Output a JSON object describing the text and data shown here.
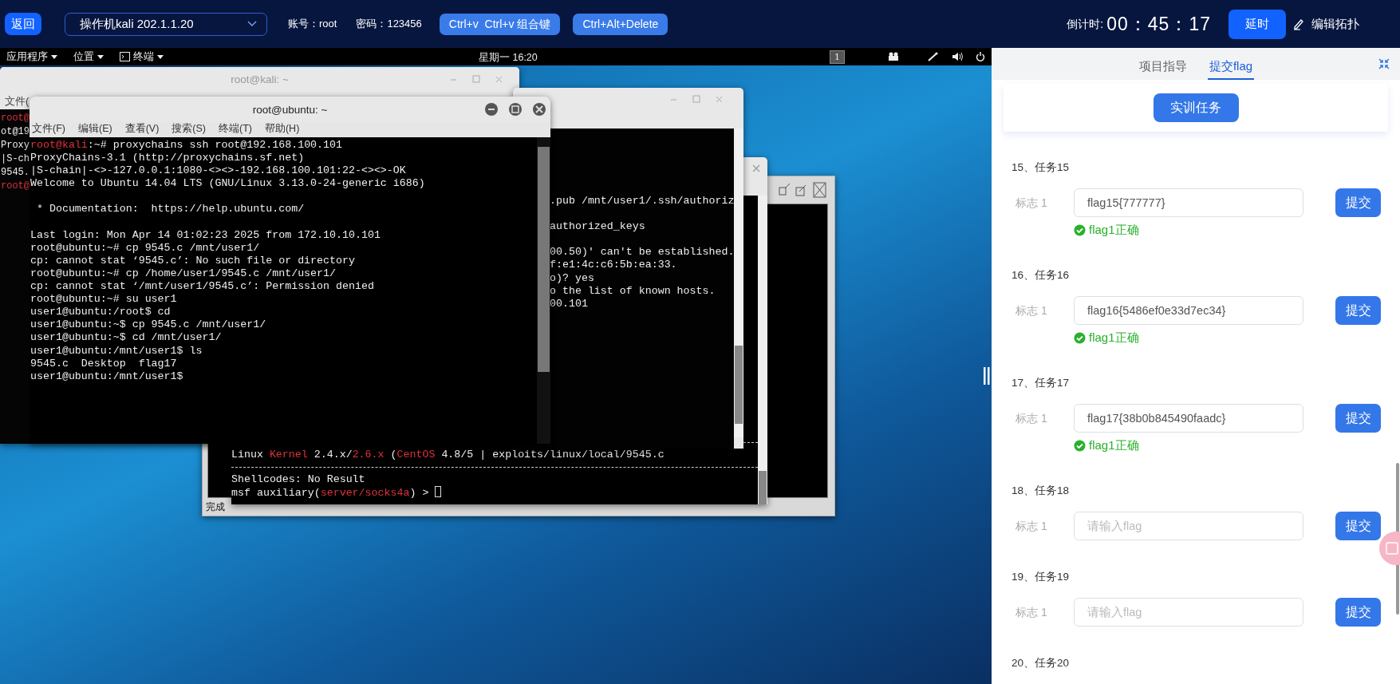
{
  "top_bar": {
    "back_button": "返回",
    "machine_select": "操作机kali 202.1.1.20",
    "account": "账号：root",
    "password": "密码：123456",
    "buttons": [
      "Ctrl+v  Ctrl+v 组合键",
      "Ctrl+Alt+Delete"
    ],
    "countdown_label": "倒计时:",
    "countdown": "00：45：17",
    "delay_button": "延时",
    "edit_topology": "编辑拓扑"
  },
  "desktop": {
    "panel": {
      "menus": [
        {
          "label": "应用程序",
          "kind": "menu"
        },
        {
          "label": "位置",
          "kind": "menu"
        },
        {
          "label": "终端",
          "kind": "terminal"
        }
      ],
      "clock": "星期一 16:20",
      "workspace": "1"
    },
    "kali_window": {
      "title": "root@kali: ~",
      "menu": "文件(",
      "lines": [
        {
          "segments": [
            {
              "text": "root@",
              "highlighted": true
            }
          ]
        },
        {
          "text": "ot@19"
        },
        {
          "text": "Proxy"
        },
        {
          "text": "|S-ch"
        },
        {
          "text": "9545."
        },
        {
          "segments": [
            {
              "text": "root@",
              "highlighted": true
            }
          ]
        }
      ]
    },
    "browser_window": {
      "status": "完成"
    },
    "msf_window": {
      "lines": [
        {
          "segments": [
            {
              "text": "Linux ",
              "highlighted": false
            },
            {
              "text": "Kernel",
              "highlighted": true
            },
            {
              "text": " 2.4.x/",
              "highlighted": false
            },
            {
              "text": "2.6.x",
              "highlighted": true
            },
            {
              "text": " (",
              "highlighted": false
            },
            {
              "text": "CentOS",
              "highlighted": true
            },
            {
              "text": " 4.8/5 | exploits/linux/local/9545.c",
              "highlighted": false
            }
          ],
          "rule_before": true,
          "rule_after": true
        },
        {
          "text": "Shellcodes: No Result"
        },
        {
          "segments": [
            {
              "text": "msf auxiliary(",
              "highlighted": false
            },
            {
              "text": "server/socks4a",
              "highlighted": true
            },
            {
              "text": ") > ",
              "highlighted": false
            }
          ],
          "cursor": true
        }
      ]
    },
    "middle_window": {
      "lines": [
        {
          "text": ".pub /mnt/user1/.ssh/authoriz"
        },
        {
          "text": "authorized_keys",
          "space_before": true
        },
        {
          "text": "00.50)' can't be established.",
          "space_before": true
        },
        {
          "text": "f:e1:4c:c6:5b:ea:33."
        },
        {
          "text": "o)? yes"
        },
        {
          "text": "o the list of known hosts."
        },
        {
          "text": "00.101"
        }
      ]
    },
    "ubuntu_window": {
      "title": "root@ubuntu: ~",
      "menu": [
        "文件(F)",
        "编辑(E)",
        "查看(V)",
        "搜索(S)",
        "终端(T)",
        "帮助(H)"
      ],
      "lines": [
        {
          "segments": [
            {
              "text": "root@kali",
              "highlighted": true
            },
            {
              "text": ":~# proxychains ssh root@192.168.100.101",
              "highlighted": false
            }
          ]
        },
        {
          "text": "ProxyChains-3.1 (http://proxychains.sf.net)"
        },
        {
          "text": "|S-chain|-<>-127.0.0.1:1080-<><>-192.168.100.101:22-<><>-OK"
        },
        {
          "text": "Welcome to Ubuntu 14.04 LTS (GNU/Linux 3.13.0-24-generic i686)"
        },
        {
          "text": " * Documentation:  https://help.ubuntu.com/",
          "space_before": true
        },
        {
          "text": "Last login: Mon Apr 14 01:02:23 2025 from 172.10.10.101",
          "space_before": true
        },
        {
          "text": "root@ubuntu:~# cp 9545.c /mnt/user1/"
        },
        {
          "text": "cp: cannot stat ‘9545.c’: No such file or directory"
        },
        {
          "text": "root@ubuntu:~# cp /home/user1/9545.c /mnt/user1/"
        },
        {
          "text": "cp: cannot stat ‘/mnt/user1/9545.c’: Permission denied"
        },
        {
          "text": "root@ubuntu:~# su user1"
        },
        {
          "text": "user1@ubuntu:/root$ cd"
        },
        {
          "text": "user1@ubuntu:~$ cp 9545.c /mnt/user1/"
        },
        {
          "text": "user1@ubuntu:~$ cd /mnt/user1/"
        },
        {
          "text": "user1@ubuntu:/mnt/user1$ ls"
        },
        {
          "text": "9545.c  Desktop  flag17"
        },
        {
          "text": "user1@ubuntu:/mnt/user1$"
        }
      ]
    }
  },
  "side_panel": {
    "tabs": [
      {
        "label": "项目指导",
        "selected": false
      },
      {
        "label": "提交flag",
        "selected": true
      }
    ],
    "task_button": "实训任务",
    "tasks": [
      {
        "title": "15、任务15",
        "label": "标志 1",
        "value": "flag15{777777}",
        "button": "提交",
        "result": "flag1正确"
      },
      {
        "title": "16、任务16",
        "label": "标志 1",
        "value": "flag16{5486ef0e33d7ec34}",
        "button": "提交",
        "result": "flag1正确"
      },
      {
        "title": "17、任务17",
        "label": "标志 1",
        "value": "flag17{38b0b845490faadc}",
        "button": "提交",
        "result": "flag1正确"
      },
      {
        "title": "18、任务18",
        "label": "标志 1",
        "placeholder": "请输入flag",
        "button": "提交"
      },
      {
        "title": "19、任务19",
        "label": "标志 1",
        "placeholder": "请输入flag",
        "button": "提交"
      },
      {
        "title": "20、任务20"
      }
    ]
  }
}
